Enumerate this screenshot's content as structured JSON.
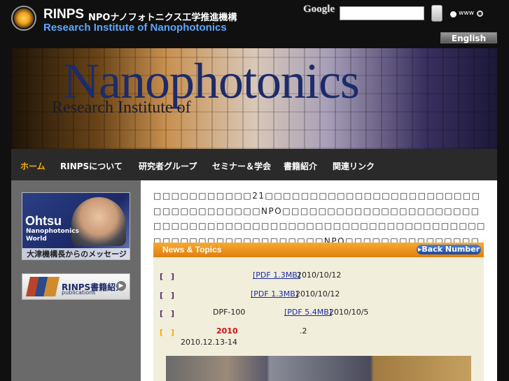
{
  "header": {
    "logo_short": "RINPS",
    "logo_japanese": "NPOナノフォトニクス工学推進機構",
    "logo_english": "Research Institute of Nanophotonics",
    "search": {
      "provider_logo": "Google",
      "placeholder": "",
      "radio_www_label": "www"
    },
    "language_button": "English"
  },
  "banner": {
    "title": "Nanophotonics",
    "subtitle": "Research Institute of"
  },
  "nav": {
    "items": [
      {
        "label": "ホーム",
        "active": true
      },
      {
        "label": "RINPSについて"
      },
      {
        "label": "研究者グループ"
      },
      {
        "label": "セミナー＆学会"
      },
      {
        "label": "書籍紹介"
      },
      {
        "label": "関連リンク"
      }
    ]
  },
  "sidebar": {
    "ohtsu": {
      "title": "Ohtsu",
      "sub1": "Nanophotonics",
      "sub2": "World",
      "caption": "大津機構長からのメッセージ"
    },
    "books": {
      "label": "RINPS書籍紹介",
      "sub": "publications"
    }
  },
  "main": {
    "intro": "□□□□□□□□□□□21□□□□□□□□□□□□□□□□□□□□□□□□□□□□□□□□□□□□NPO□□□□□□□□□□□□□□□□□□□□□□□□□□□□□□□□□□□□□□□□□□□□□□□□□□□□□□□□□□□□□□□□□□□□□□□□□□□□□□NPO□□□□□□□□□□□□□□□□□□□□□□□□□□□□□□□□□□□□□□□□□□",
    "news": {
      "title": "News & Topics",
      "back_number": "Back Number",
      "items": [
        {
          "bracket": "[　]",
          "pdf": "[PDF 1.3MB]",
          "date": "2010/10/12"
        },
        {
          "bracket": "[　]",
          "pdf": "[PDF 1.3MB]",
          "date": "2010/10/12"
        },
        {
          "bracket": "[　]",
          "prefix": "DPF-100",
          "pdf": "[PDF 5.4MB]",
          "date": "2010/10/5"
        },
        {
          "bracket": "[　]",
          "year": "2010",
          "suffix": ".2",
          "date": "2010.12.13-14"
        }
      ]
    }
  },
  "colors": {
    "accent_orange": "#f7a932",
    "nav_active": "#f7b000",
    "link_blue": "#1a2aa8",
    "news_bg": "#f2eedc"
  }
}
